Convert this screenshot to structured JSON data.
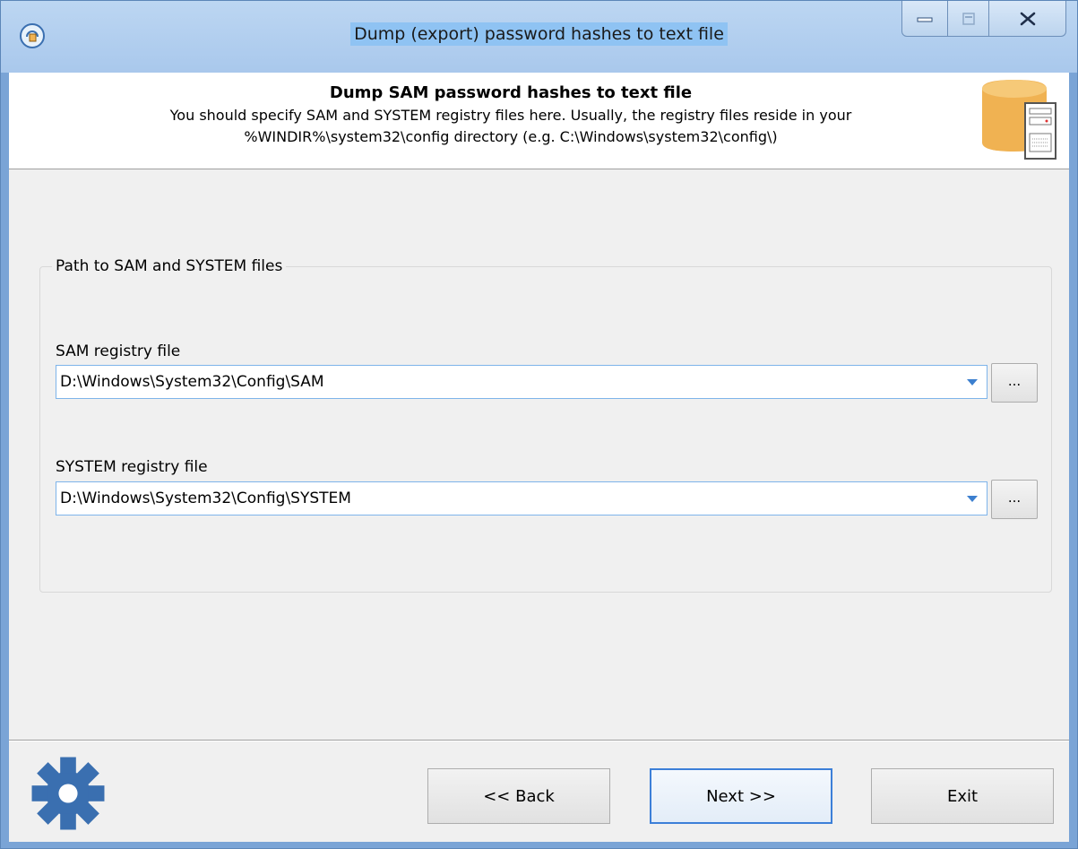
{
  "window": {
    "title": "Dump (export) password hashes to text file",
    "controls": {
      "minimize_icon": "minimize-icon",
      "maximize_icon": "maximize-icon",
      "close_icon": "close-icon"
    }
  },
  "header": {
    "title": "Dump SAM password hashes to text file",
    "description_line1": "You should specify SAM and SYSTEM registry files here. Usually, the registry files reside in your",
    "description_line2": "%WINDIR%\\system32\\config directory (e.g. C:\\Windows\\system32\\config\\)"
  },
  "group": {
    "legend": "Path to SAM and SYSTEM files",
    "sam": {
      "label": "SAM registry file",
      "value": "D:\\Windows\\System32\\Config\\SAM",
      "browse_label": "..."
    },
    "system": {
      "label": "SYSTEM registry file",
      "value": "D:\\Windows\\System32\\Config\\SYSTEM",
      "browse_label": "..."
    }
  },
  "footer": {
    "back_label": "<< Back",
    "next_label": "Next >>",
    "exit_label": "Exit"
  },
  "colors": {
    "title_highlight": "#8fc3f3",
    "accent": "#3c7fd8",
    "gear": "#3a6fb0",
    "database": "#f0b252"
  }
}
